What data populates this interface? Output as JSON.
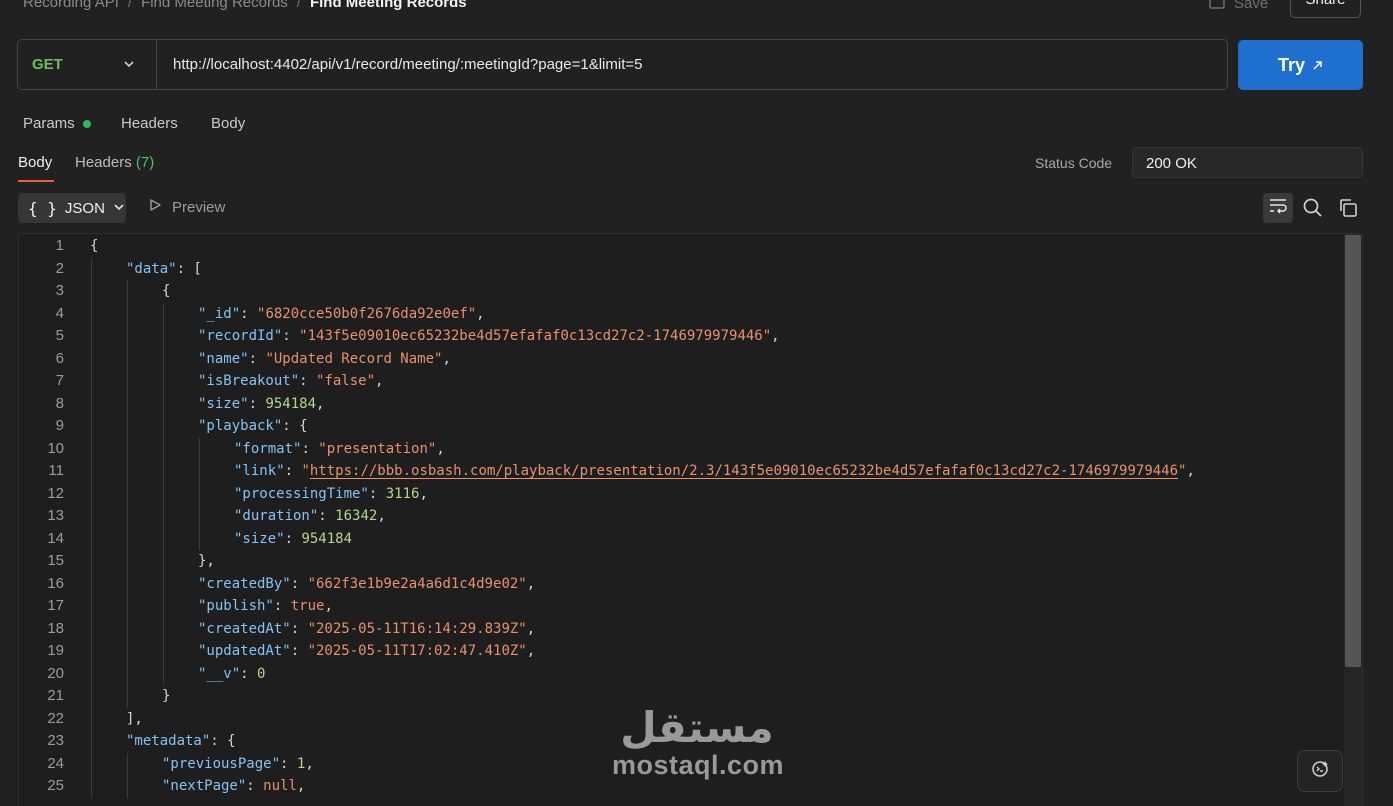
{
  "breadcrumb": [
    "Recording API",
    "Find Meeting Records",
    "Find Meeting Records"
  ],
  "toolbar": {
    "save_label": "Save",
    "share_label": "Share"
  },
  "request": {
    "method": "GET",
    "url": "http://localhost:4402/api/v1/record/meeting/:meetingId?page=1&limit=5",
    "try_label": "Try",
    "tabs": [
      "Params",
      "Headers",
      "Body"
    ]
  },
  "response": {
    "tabs": {
      "body": "Body",
      "headers": "Headers",
      "headers_count": "(7)"
    },
    "status_label": "Status Code",
    "status_value": "200 OK",
    "format": "JSON",
    "preview_label": "Preview"
  },
  "code": [
    {
      "n": "1",
      "d": 0,
      "t": [
        [
          "p",
          "{"
        ]
      ]
    },
    {
      "n": "2",
      "d": 1,
      "t": [
        [
          "k",
          "\"data\""
        ],
        [
          "p",
          ": ["
        ]
      ]
    },
    {
      "n": "3",
      "d": 2,
      "t": [
        [
          "p",
          "{"
        ]
      ]
    },
    {
      "n": "4",
      "d": 3,
      "t": [
        [
          "k",
          "\"_id\""
        ],
        [
          "p",
          ": "
        ],
        [
          "s",
          "\"6820cce50b0f2676da92e0ef\""
        ],
        [
          "p",
          ","
        ]
      ]
    },
    {
      "n": "5",
      "d": 3,
      "t": [
        [
          "k",
          "\"recordId\""
        ],
        [
          "p",
          ": "
        ],
        [
          "s",
          "\"143f5e09010ec65232be4d57efafaf0c13cd27c2-1746979979446\""
        ],
        [
          "p",
          ","
        ]
      ]
    },
    {
      "n": "6",
      "d": 3,
      "t": [
        [
          "k",
          "\"name\""
        ],
        [
          "p",
          ": "
        ],
        [
          "s",
          "\"Updated Record Name\""
        ],
        [
          "p",
          ","
        ]
      ]
    },
    {
      "n": "7",
      "d": 3,
      "t": [
        [
          "k",
          "\"isBreakout\""
        ],
        [
          "p",
          ": "
        ],
        [
          "s",
          "\"false\""
        ],
        [
          "p",
          ","
        ]
      ]
    },
    {
      "n": "8",
      "d": 3,
      "t": [
        [
          "k",
          "\"size\""
        ],
        [
          "p",
          ": "
        ],
        [
          "n",
          "954184"
        ],
        [
          "p",
          ","
        ]
      ]
    },
    {
      "n": "9",
      "d": 3,
      "t": [
        [
          "k",
          "\"playback\""
        ],
        [
          "p",
          ": {"
        ]
      ]
    },
    {
      "n": "10",
      "d": 4,
      "t": [
        [
          "k",
          "\"format\""
        ],
        [
          "p",
          ": "
        ],
        [
          "s",
          "\"presentation\""
        ],
        [
          "p",
          ","
        ]
      ]
    },
    {
      "n": "11",
      "d": 4,
      "t": [
        [
          "k",
          "\"link\""
        ],
        [
          "p",
          ": "
        ],
        [
          "s",
          "\""
        ],
        [
          "u",
          "https://bbb.osbash.com/playback/presentation/2.3/143f5e09010ec65232be4d57efafaf0c13cd27c2-1746979979446"
        ],
        [
          "s",
          "\""
        ],
        [
          "p",
          ","
        ]
      ]
    },
    {
      "n": "12",
      "d": 4,
      "t": [
        [
          "k",
          "\"processingTime\""
        ],
        [
          "p",
          ": "
        ],
        [
          "n",
          "3116"
        ],
        [
          "p",
          ","
        ]
      ]
    },
    {
      "n": "13",
      "d": 4,
      "t": [
        [
          "k",
          "\"duration\""
        ],
        [
          "p",
          ": "
        ],
        [
          "n",
          "16342"
        ],
        [
          "p",
          ","
        ]
      ]
    },
    {
      "n": "14",
      "d": 4,
      "t": [
        [
          "k",
          "\"size\""
        ],
        [
          "p",
          ": "
        ],
        [
          "n",
          "954184"
        ]
      ]
    },
    {
      "n": "15",
      "d": 3,
      "t": [
        [
          "p",
          "},"
        ]
      ]
    },
    {
      "n": "16",
      "d": 3,
      "t": [
        [
          "k",
          "\"createdBy\""
        ],
        [
          "p",
          ": "
        ],
        [
          "s",
          "\"662f3e1b9e2a4a6d1c4d9e02\""
        ],
        [
          "p",
          ","
        ]
      ]
    },
    {
      "n": "17",
      "d": 3,
      "t": [
        [
          "k",
          "\"publish\""
        ],
        [
          "p",
          ": "
        ],
        [
          "b",
          "true"
        ],
        [
          "p",
          ","
        ]
      ]
    },
    {
      "n": "18",
      "d": 3,
      "t": [
        [
          "k",
          "\"createdAt\""
        ],
        [
          "p",
          ": "
        ],
        [
          "s",
          "\"2025-05-11T16:14:29.839Z\""
        ],
        [
          "p",
          ","
        ]
      ]
    },
    {
      "n": "19",
      "d": 3,
      "t": [
        [
          "k",
          "\"updatedAt\""
        ],
        [
          "p",
          ": "
        ],
        [
          "s",
          "\"2025-05-11T17:02:47.410Z\""
        ],
        [
          "p",
          ","
        ]
      ]
    },
    {
      "n": "20",
      "d": 3,
      "t": [
        [
          "k",
          "\"__v\""
        ],
        [
          "p",
          ": "
        ],
        [
          "n",
          "0"
        ]
      ]
    },
    {
      "n": "21",
      "d": 2,
      "t": [
        [
          "p",
          "}"
        ]
      ]
    },
    {
      "n": "22",
      "d": 1,
      "t": [
        [
          "p",
          "],"
        ]
      ]
    },
    {
      "n": "23",
      "d": 1,
      "t": [
        [
          "k",
          "\"metadata\""
        ],
        [
          "p",
          ": {"
        ]
      ]
    },
    {
      "n": "24",
      "d": 2,
      "t": [
        [
          "k",
          "\"previousPage\""
        ],
        [
          "p",
          ": "
        ],
        [
          "n",
          "1"
        ],
        [
          "p",
          ","
        ]
      ]
    },
    {
      "n": "25",
      "d": 2,
      "t": [
        [
          "k",
          "\"nextPage\""
        ],
        [
          "p",
          ": "
        ],
        [
          "b",
          "null"
        ],
        [
          "p",
          ","
        ]
      ]
    }
  ],
  "watermark": {
    "arabic": "مستقل",
    "latin": "mostaql.com"
  },
  "colors": {
    "accent": "#1f6fd1",
    "method_get": "#6bbf59",
    "status_dot": "#2fb955",
    "active_tab": "#e2653a"
  },
  "icons": [
    "save-icon",
    "chevron-down-icon",
    "external-arrow-icon",
    "play-icon",
    "wrap-lines-icon",
    "search-icon",
    "copy-icon",
    "assistant-icon"
  ]
}
